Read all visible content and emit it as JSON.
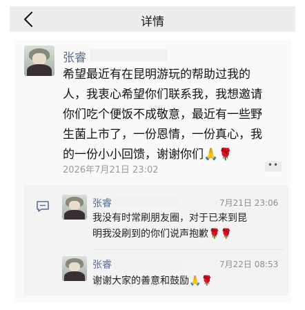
{
  "nav": {
    "title": "详情"
  },
  "post": {
    "author": "张睿",
    "lines": [
      "希望最近有在昆明游玩的帮助过我的",
      "人，我衷心希望你们联系我，我想邀请",
      "你们吃个便饭不成敬意，最近有一些野",
      "生菌上市了，一份恩情，一份真心，我",
      "的一份小小回馈，谢谢你们🙏🌹"
    ],
    "timestamp": "2026年7月21日 23:02",
    "more_icon": "ellipsis-icon"
  },
  "comments": [
    {
      "author": "张睿",
      "time": "7月21日 23:06",
      "lines": [
        "我没有时常刷朋友圈，对于已来到昆",
        "明我没刷到的你们说声抱歉🌹🌹"
      ]
    },
    {
      "author": "张睿",
      "time": "7月22日 08:53",
      "lines": [
        "谢谢大家的善意和鼓励🙏🌹"
      ]
    }
  ],
  "colors": {
    "nav_bg": "#ededed",
    "name": "#576b95",
    "timestamp": "#9a9a9a",
    "comment_bg": "#f3f3f3"
  }
}
